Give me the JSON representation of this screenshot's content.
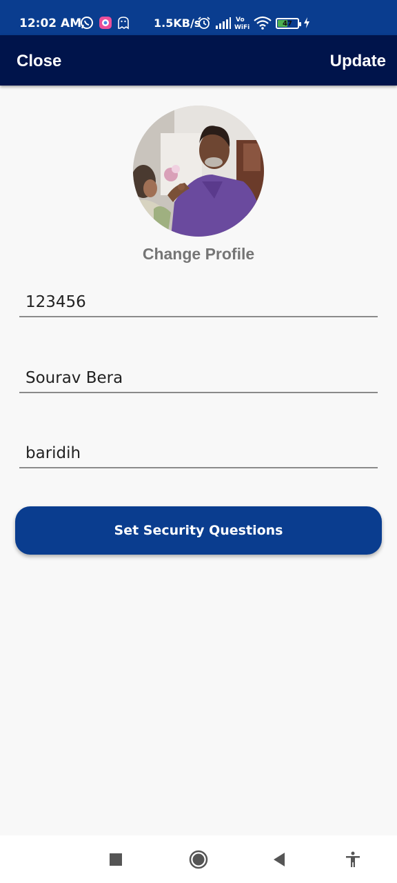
{
  "status_bar": {
    "time": "12:02 AM",
    "network_speed": "1.5KB/s",
    "battery_level": "47",
    "icons": [
      "whatsapp-icon",
      "app-launcher-icon",
      "ghost-icon",
      "alarm-icon",
      "signal-icon",
      "vowifi-icon",
      "wifi-icon",
      "battery-icon",
      "charging-icon"
    ]
  },
  "app_bar": {
    "close_label": "Close",
    "update_label": "Update",
    "background": "#00144b"
  },
  "profile": {
    "change_profile_label": "Change Profile"
  },
  "form": {
    "field1_value": "123456",
    "field2_value": "Sourav Bera",
    "field3_value": "baridih"
  },
  "security_button": {
    "label": "Set Security Questions",
    "color": "#0a3d8f"
  },
  "nav_bar": {
    "icons": [
      "recents-square-icon",
      "home-circle-icon",
      "back-triangle-icon",
      "accessibility-icon"
    ]
  }
}
